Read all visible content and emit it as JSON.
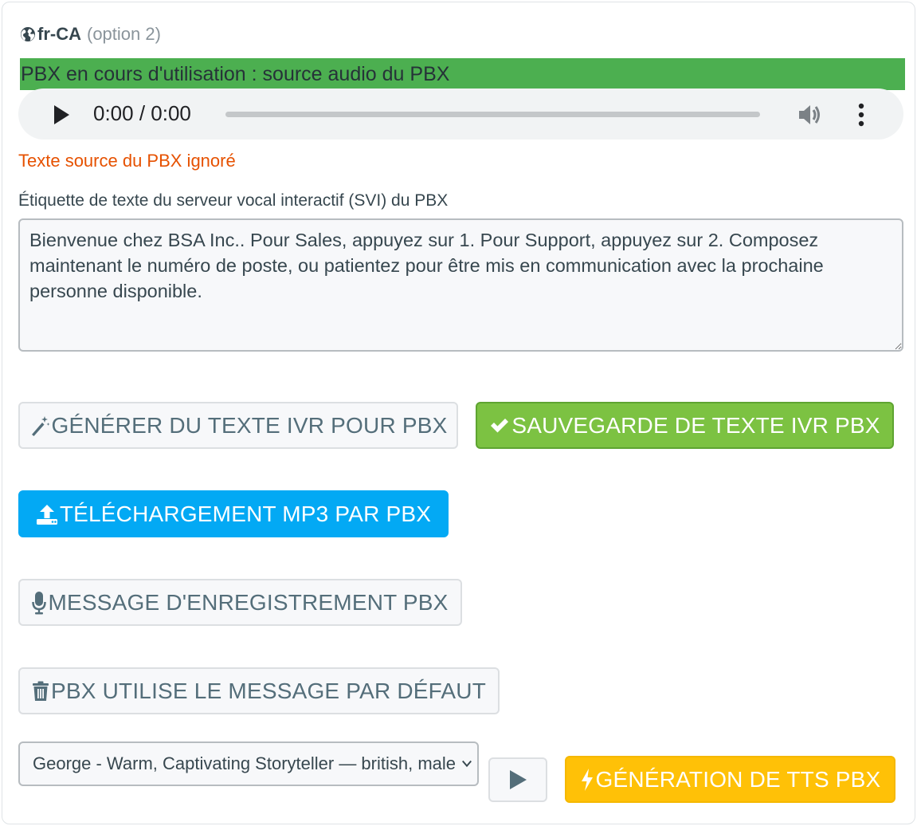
{
  "language": {
    "code": "fr-CA",
    "option": "(option 2)",
    "icon": "globe-icon"
  },
  "status": {
    "text": "PBX en cours d'utilisation : source audio du PBX",
    "color": "#4caf50"
  },
  "audio_player": {
    "time": "0:00 / 0:00",
    "progress": 0,
    "icons": [
      "play-icon",
      "volume-icon",
      "more-vert-icon"
    ]
  },
  "ignored_notice": {
    "text": "Texte source du PBX ignoré",
    "color": "#e65100"
  },
  "ivr_field": {
    "label": "Étiquette de texte du serveur vocal interactif (SVI) du PBX",
    "value": "Bienvenue chez BSA Inc.. Pour Sales, appuyez sur 1. Pour Support, appuyez sur 2. Composez maintenant le numéro de poste, ou patientez pour être mis en communication avec la prochaine personne disponible."
  },
  "buttons": {
    "generate": {
      "label": "GÉNÉRER DU TEXTE IVR POUR PBX",
      "icon": "magic-wand-icon"
    },
    "save": {
      "label": "SAUVEGARDE DE TEXTE IVR PBX",
      "icon": "check-icon",
      "color": "#7cc242"
    },
    "upload": {
      "label": "TÉLÉCHARGEMENT MP3 PAR PBX",
      "icon": "upload-icon",
      "color": "#03a9f4"
    },
    "record": {
      "label": "MESSAGE D'ENREGISTREMENT PBX",
      "icon": "microphone-icon"
    },
    "default": {
      "label": "PBX UTILISE LE MESSAGE PAR DÉFAUT",
      "icon": "trash-icon"
    },
    "tts": {
      "label": "GÉNÉRATION DE TTS PBX",
      "icon": "bolt-icon",
      "color": "#ffc107"
    }
  },
  "voice": {
    "selected": "George - Warm, Captivating Storyteller — british, male",
    "preview_icon": "play-icon"
  }
}
